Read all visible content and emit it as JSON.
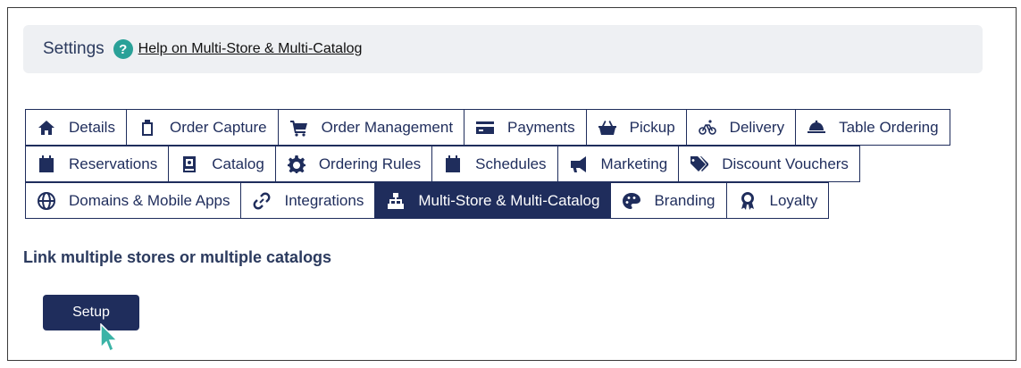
{
  "header": {
    "title": "Settings",
    "help_icon": "question-circle-icon",
    "help_link": "Help on Multi-Store & Multi-Catalog"
  },
  "tabs": {
    "row1": [
      {
        "label": "Details",
        "icon": "home-icon"
      },
      {
        "label": "Order Capture",
        "icon": "clipboard-icon"
      },
      {
        "label": "Order Management",
        "icon": "cart-icon"
      },
      {
        "label": "Payments",
        "icon": "credit-card-icon"
      },
      {
        "label": "Pickup",
        "icon": "basket-icon"
      },
      {
        "label": "Delivery",
        "icon": "bicycle-icon"
      },
      {
        "label": "Table Ordering",
        "icon": "cloche-icon"
      }
    ],
    "row2": [
      {
        "label": "Reservations",
        "icon": "calendar-icon"
      },
      {
        "label": "Catalog",
        "icon": "book-icon"
      },
      {
        "label": "Ordering Rules",
        "icon": "gear-icon"
      },
      {
        "label": "Schedules",
        "icon": "calendar-icon"
      },
      {
        "label": "Marketing",
        "icon": "megaphone-icon"
      },
      {
        "label": "Discount Vouchers",
        "icon": "tags-icon"
      }
    ],
    "row3": [
      {
        "label": "Domains & Mobile Apps",
        "icon": "globe-icon"
      },
      {
        "label": "Integrations",
        "icon": "link-icon"
      },
      {
        "label": "Multi-Store & Multi-Catalog",
        "icon": "sitemap-icon",
        "active": true
      },
      {
        "label": "Branding",
        "icon": "palette-icon"
      },
      {
        "label": "Loyalty",
        "icon": "award-icon"
      }
    ]
  },
  "main": {
    "heading": "Link multiple stores or multiple catalogs",
    "setup_button": "Setup"
  },
  "colors": {
    "navy": "#1f2d5c",
    "help_teal": "#2aa198",
    "cursor_teal": "#3bb3a6",
    "settings_bg": "#eef0f3"
  }
}
